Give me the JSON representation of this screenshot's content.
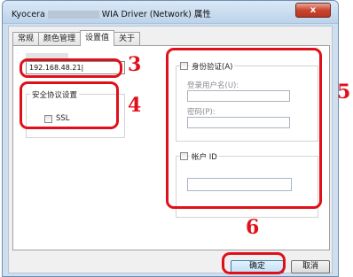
{
  "window": {
    "title_prefix": "Kyocera",
    "title_suffix": "WIA Driver (Network) 属性",
    "close_label": "x"
  },
  "tabs": [
    {
      "label": "常规"
    },
    {
      "label": "颜色管理"
    },
    {
      "label": "设置值",
      "active": true
    },
    {
      "label": "关于"
    }
  ],
  "host": {
    "value": "192.168.48.21|"
  },
  "security": {
    "legend": "安全协议设置",
    "ssl_label": "SSL",
    "ssl_checked": false
  },
  "auth": {
    "label": "身份验证(A)",
    "checked": false,
    "username_label": "登录用户名(U):",
    "username_value": "",
    "password_label": "密码(P):",
    "password_value": ""
  },
  "account": {
    "label": "帐户 ID",
    "checked": false,
    "value": ""
  },
  "buttons": {
    "ok": "确定",
    "cancel": "取消"
  },
  "annotations": {
    "step3": "3",
    "step4": "4",
    "step5": "5",
    "step6": "6",
    "color": "#e0101a"
  }
}
